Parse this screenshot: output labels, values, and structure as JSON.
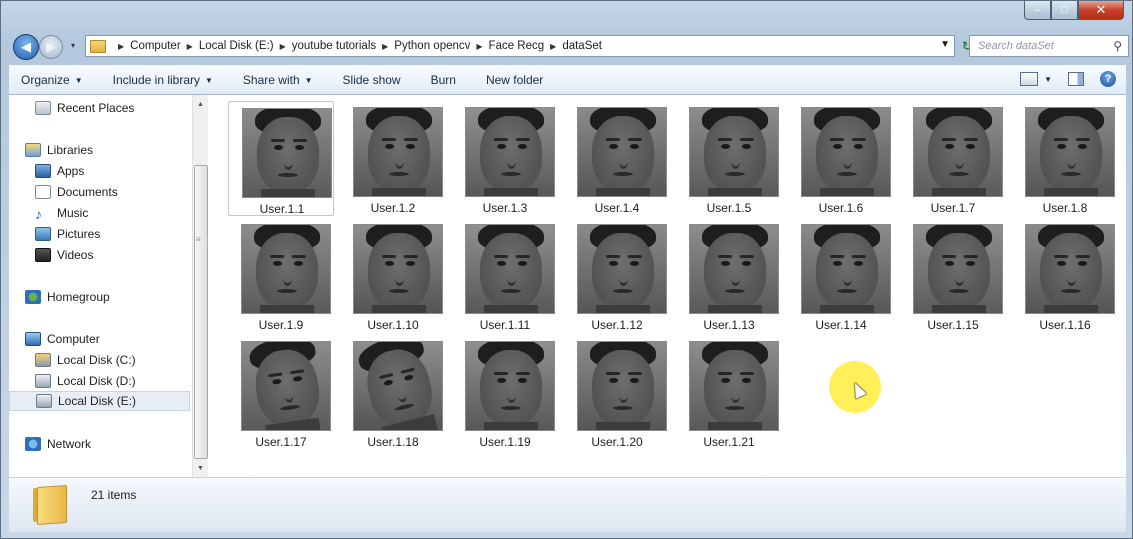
{
  "window": {
    "controls": {
      "minimize": "–",
      "maximize": "□",
      "close": "✕"
    }
  },
  "address": {
    "breadcrumbs": [
      "Computer",
      "Local Disk (E:)",
      "youtube tutorials",
      "Python opencv",
      "Face Recg",
      "dataSet"
    ],
    "dropdown_glyph": "▾",
    "refresh_glyph": "↻"
  },
  "search": {
    "placeholder": "Search dataSet",
    "icon": "search-icon"
  },
  "toolbar": {
    "organize": "Organize",
    "include": "Include in library",
    "share": "Share with",
    "slideshow": "Slide show",
    "burn": "Burn",
    "newfolder": "New folder"
  },
  "nav": {
    "items": [
      {
        "label": "Recent Places",
        "icon": "recent-places-icon"
      },
      {
        "label": "Libraries",
        "icon": "libraries-icon"
      },
      {
        "label": "Apps",
        "icon": "apps-icon"
      },
      {
        "label": "Documents",
        "icon": "documents-icon"
      },
      {
        "label": "Music",
        "icon": "music-icon"
      },
      {
        "label": "Pictures",
        "icon": "pictures-icon"
      },
      {
        "label": "Videos",
        "icon": "videos-icon"
      },
      {
        "label": "Homegroup",
        "icon": "homegroup-icon"
      },
      {
        "label": "Computer",
        "icon": "computer-icon"
      },
      {
        "label": "Local Disk (C:)",
        "icon": "disk-icon"
      },
      {
        "label": "Local Disk (D:)",
        "icon": "disk-icon"
      },
      {
        "label": "Local Disk (E:)",
        "icon": "disk-icon",
        "selected": true
      },
      {
        "label": "Network",
        "icon": "network-icon"
      }
    ]
  },
  "files": [
    "User.1.1",
    "User.1.2",
    "User.1.3",
    "User.1.4",
    "User.1.5",
    "User.1.6",
    "User.1.7",
    "User.1.8",
    "User.1.9",
    "User.1.10",
    "User.1.11",
    "User.1.12",
    "User.1.13",
    "User.1.14",
    "User.1.15",
    "User.1.16",
    "User.1.17",
    "User.1.18",
    "User.1.19",
    "User.1.20",
    "User.1.21"
  ],
  "status": {
    "count": "21 items"
  },
  "colors": {
    "cursor_highlight": "#ffec3c",
    "selection": "#e7eef6"
  }
}
